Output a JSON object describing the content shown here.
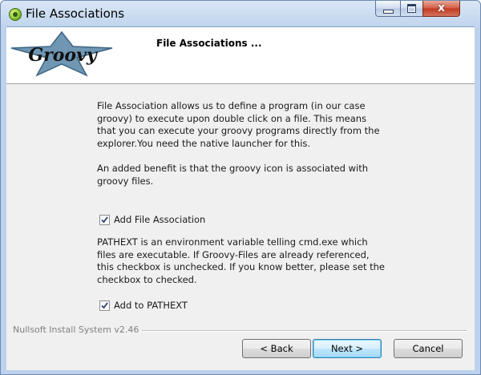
{
  "window": {
    "title": "File Associations"
  },
  "header": {
    "title": "File Associations ...",
    "logo_text": "Groovy",
    "logo_icon": "groovy-star-logo"
  },
  "content": {
    "paragraph1": "File Association allows us to define a program (in our case groovy) to execute upon double click on a file. This means that you can execute your groovy programs directly from the explorer.You need the native launcher for this.",
    "paragraph2": "An added benefit is that the groovy icon is associated with groovy files.",
    "checkbox_file_assoc": {
      "label": "Add File Association",
      "checked": true
    },
    "paragraph3": "PATHEXT is an environment variable telling cmd.exe which files are executable. If Groovy-Files are already referenced, this checkbox is unchecked.  If you know better, please set the checkbox to checked.",
    "checkbox_pathext": {
      "label": "Add to PATHEXT",
      "checked": true
    }
  },
  "footer": {
    "branding": "Nullsoft Install System v2.46",
    "back_label": "< Back",
    "next_label": "Next >",
    "cancel_label": "Cancel"
  },
  "titlebar_buttons": {
    "minimize_icon": "minimize-icon",
    "maximize_icon": "maximize-icon",
    "close_icon": "close-icon",
    "close_glyph": "x"
  }
}
